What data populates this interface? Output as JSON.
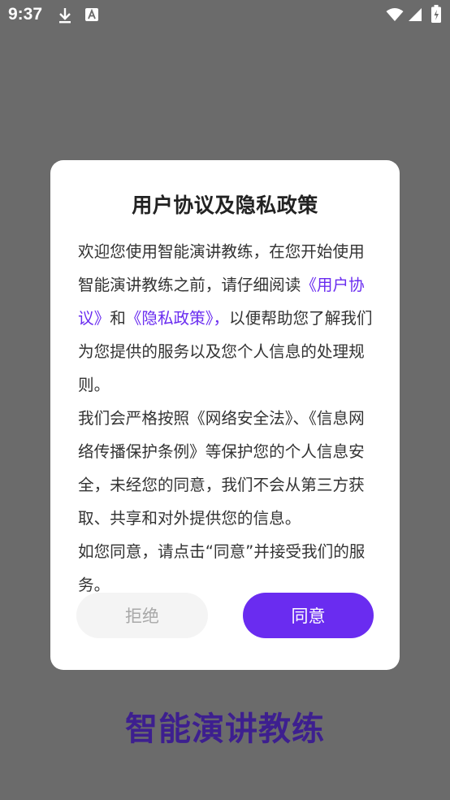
{
  "status_bar": {
    "time": "9:37",
    "icons": [
      "download-icon",
      "text-a-icon",
      "wifi-icon",
      "signal-icon",
      "battery-icon"
    ]
  },
  "dialog": {
    "title": "用户协议及隐私政策",
    "para1": {
      "before": "欢迎您使用智能演讲教练，在您开始使用智能演讲教练之前，请仔细阅读",
      "link_user_agreement": "《用户协议》",
      "and": "和",
      "link_privacy_policy": "《隐私政策》，",
      "after": "以便帮助您了解我们为您提供的服务以及您个人信息的处理规则。"
    },
    "para2": "我们会严格按照《网络安全法》、《信息网络传播保护条例》等保护您的个人信息安全，未经您的同意，我们不会从第三方获取、共享和对外提供您的信息。",
    "para3": "如您同意，请点击“同意”并接受我们的服务。",
    "reject_label": "拒绝",
    "agree_label": "同意"
  },
  "brand": "智能演讲教练",
  "colors": {
    "accent": "#6a2cf0",
    "overlay": "#6b6b6b",
    "brand_text": "#3d1f8f"
  }
}
